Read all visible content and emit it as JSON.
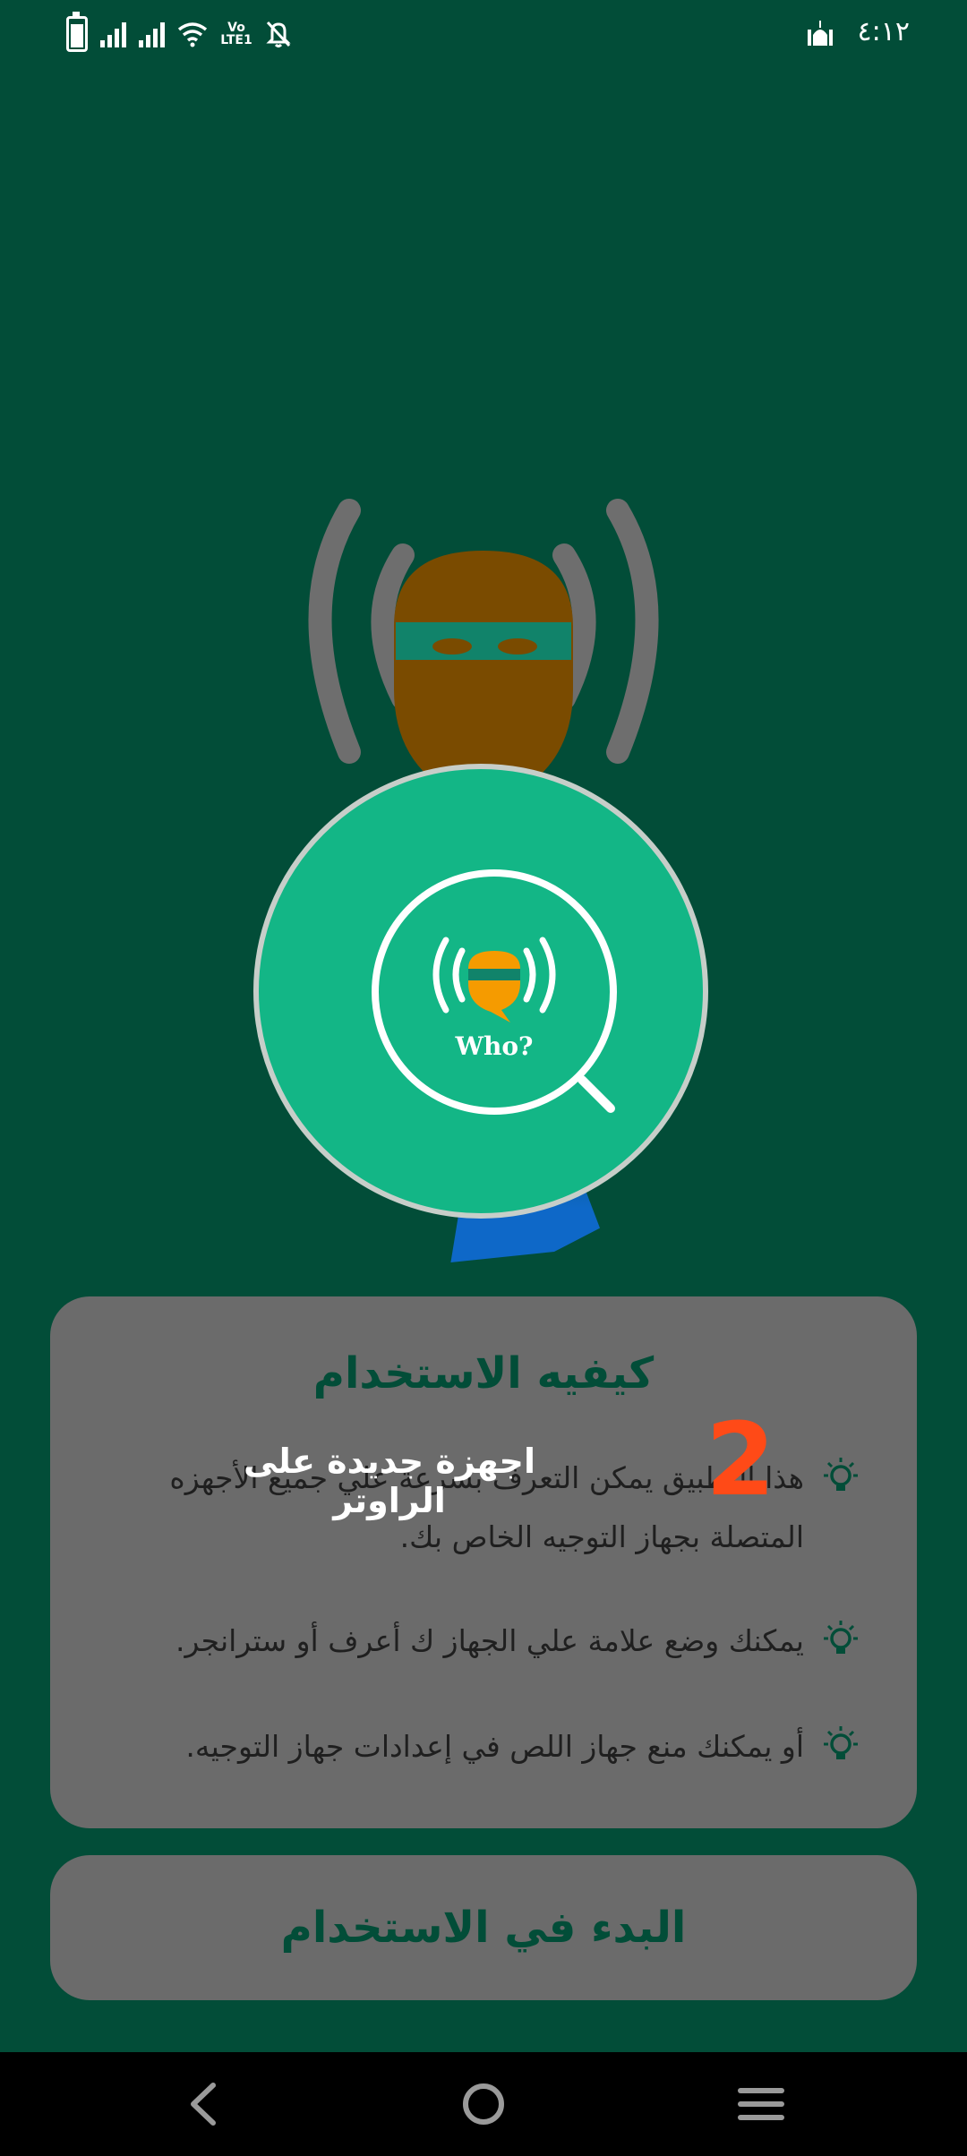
{
  "status_bar": {
    "time": "٤:١٢",
    "volte_label": "Vo LTE1",
    "icons": [
      "battery-icon",
      "signal-icon",
      "signal-icon",
      "wifi-icon",
      "volte-icon",
      "mute-icon",
      "mosque-icon"
    ]
  },
  "logo": {
    "text": "Who?"
  },
  "overlay": {
    "label": "اجهزة جديدة على الراوتر",
    "step_number": "2"
  },
  "how_to_use": {
    "title": "كيفيه الاستخدام",
    "tips": [
      "هذا التطبيق يمكن التعرف بسرعة علي جميع الأجهزه المتصلة بجهاز التوجيه الخاص بك.",
      "يمكنك وضع علامة علي الجهاز ك أعرف أو سترانجر.",
      "أو يمكنك منع جهاز اللص في إعدادات جهاز التوجيه."
    ]
  },
  "start_button": {
    "label": "البدء في الاستخدام"
  },
  "nav": {
    "items": [
      "back",
      "home",
      "menu"
    ]
  },
  "colors": {
    "background": "#024d38",
    "accent_green": "#13b686",
    "card_grey": "#6b6b6b",
    "step_orange": "#ff4a17",
    "thief_orange": "#f59b00"
  }
}
